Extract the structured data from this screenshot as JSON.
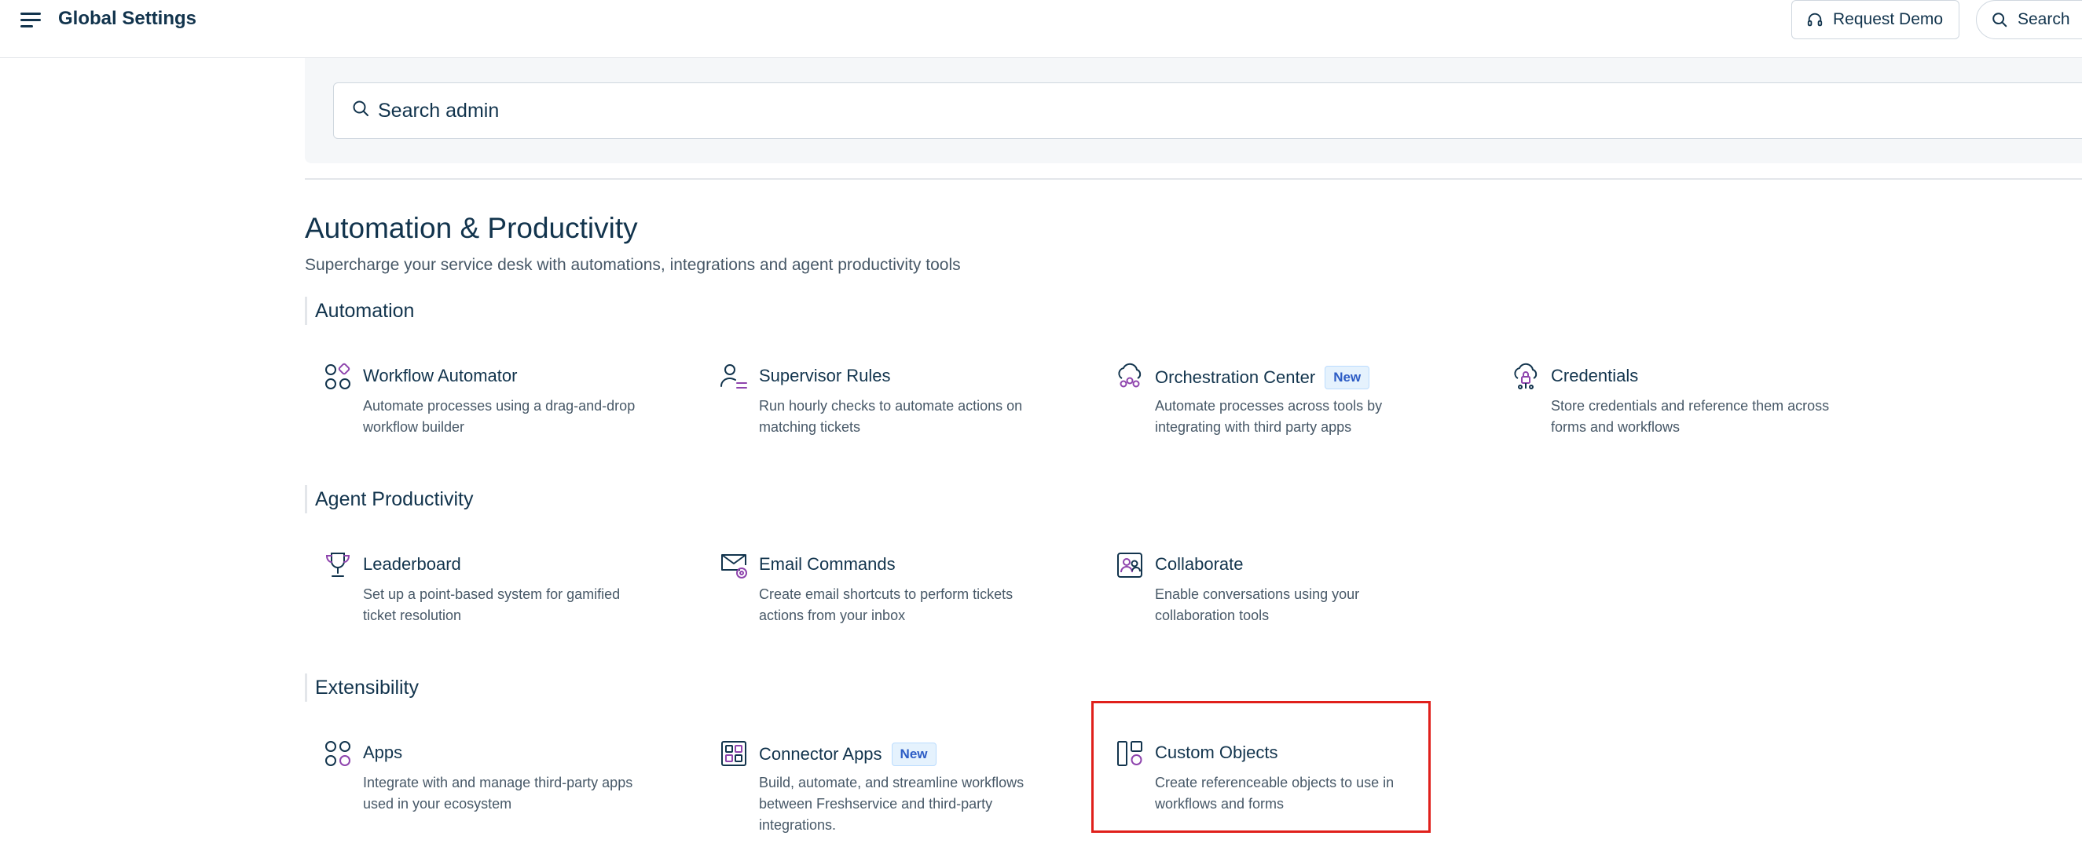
{
  "header": {
    "title": "Global Settings",
    "request_demo_label": "Request Demo",
    "search_label": "Search"
  },
  "admin_search": {
    "placeholder": "Search admin"
  },
  "section": {
    "title": "Automation & Productivity",
    "subtitle": "Supercharge your service desk with automations, integrations and agent productivity tools"
  },
  "groups": [
    {
      "label": "Automation",
      "items": [
        {
          "title": "Workflow Automator",
          "desc": "Automate processes using a drag-and-drop workflow builder",
          "icon": "workflow-automator-icon"
        },
        {
          "title": "Supervisor Rules",
          "desc": "Run hourly checks to automate actions on matching tickets",
          "icon": "supervisor-rules-icon"
        },
        {
          "title": "Orchestration Center",
          "badge": "New",
          "desc": "Automate processes across tools by integrating with third party apps",
          "icon": "orchestration-center-icon"
        },
        {
          "title": "Credentials",
          "desc": "Store credentials and reference them across forms and workflows",
          "icon": "credentials-icon"
        }
      ]
    },
    {
      "label": "Agent Productivity",
      "items": [
        {
          "title": "Leaderboard",
          "desc": "Set up a point-based system for gamified ticket resolution",
          "icon": "trophy-icon"
        },
        {
          "title": "Email Commands",
          "desc": "Create email shortcuts to perform tickets actions from your inbox",
          "icon": "email-commands-icon"
        },
        {
          "title": "Collaborate",
          "desc": "Enable conversations using your collaboration tools",
          "icon": "collaborate-icon"
        }
      ]
    },
    {
      "label": "Extensibility",
      "items": [
        {
          "title": "Apps",
          "desc": "Integrate with and manage third-party apps used in your ecosystem",
          "icon": "apps-icon"
        },
        {
          "title": "Connector Apps",
          "badge": "New",
          "desc": "Build, automate, and streamline workflows between Freshservice and third-party integrations.",
          "icon": "connector-apps-icon"
        },
        {
          "title": "Custom Objects",
          "desc": "Create referenceable objects to use in workflows and forms",
          "icon": "custom-objects-icon"
        }
      ]
    }
  ],
  "colors": {
    "text_primary": "#12344d",
    "text_secondary": "#475867",
    "icon_accent": "#8e44ad",
    "badge_bg": "#e5f2fd",
    "badge_text": "#2c5cc5",
    "highlight": "#e0201b"
  }
}
